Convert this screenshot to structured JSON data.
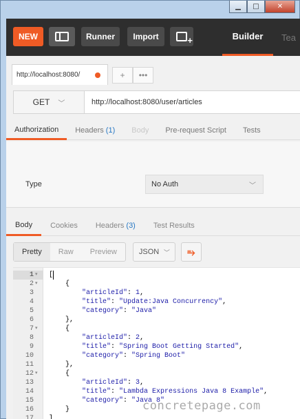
{
  "header": {
    "new_label": "NEW",
    "runner_label": "Runner",
    "import_label": "Import",
    "builder_tab": "Builder",
    "team_tab": "Tea"
  },
  "request_tab": {
    "label": "http://localhost:8080/",
    "add_label": "+",
    "more_label": "•••"
  },
  "request": {
    "method": "GET",
    "url": "http://localhost:8080/user/articles"
  },
  "request_tabs": {
    "authorization": "Authorization",
    "headers": "Headers",
    "headers_count": "(1)",
    "body": "Body",
    "prerequest": "Pre-request Script",
    "tests": "Tests"
  },
  "auth": {
    "type_label": "Type",
    "type_value": "No Auth"
  },
  "response_tabs": {
    "body": "Body",
    "cookies": "Cookies",
    "headers": "Headers",
    "headers_count": "(3)",
    "test_results": "Test Results"
  },
  "view": {
    "pretty": "Pretty",
    "raw": "Raw",
    "preview": "Preview",
    "format": "JSON"
  },
  "code_lines": [
    {
      "n": "1",
      "fold": "▾",
      "text": "["
    },
    {
      "n": "2",
      "fold": "▾",
      "text": "    {"
    },
    {
      "n": "3",
      "fold": "",
      "text": "        \"articleId\": 1,"
    },
    {
      "n": "4",
      "fold": "",
      "text": "        \"title\": \"Update:Java Concurrency\","
    },
    {
      "n": "5",
      "fold": "",
      "text": "        \"category\": \"Java\""
    },
    {
      "n": "6",
      "fold": "",
      "text": "    },"
    },
    {
      "n": "7",
      "fold": "▾",
      "text": "    {"
    },
    {
      "n": "8",
      "fold": "",
      "text": "        \"articleId\": 2,"
    },
    {
      "n": "9",
      "fold": "",
      "text": "        \"title\": \"Spring Boot Getting Started\","
    },
    {
      "n": "10",
      "fold": "",
      "text": "        \"category\": \"Spring Boot\""
    },
    {
      "n": "11",
      "fold": "",
      "text": "    },"
    },
    {
      "n": "12",
      "fold": "▾",
      "text": "    {"
    },
    {
      "n": "13",
      "fold": "",
      "text": "        \"articleId\": 3,"
    },
    {
      "n": "14",
      "fold": "",
      "text": "        \"title\": \"Lambda Expressions Java 8 Example\","
    },
    {
      "n": "15",
      "fold": "",
      "text": "        \"category\": \"Java 8\""
    },
    {
      "n": "16",
      "fold": "",
      "text": "    }"
    },
    {
      "n": "17",
      "fold": "",
      "text": "]"
    }
  ],
  "watermark": "concretepage.com",
  "colors": {
    "accent": "#ef5b25",
    "header_bg": "#2e2e2e",
    "link_count": "#2778c4"
  },
  "icons": {
    "minimize": "minimize-icon",
    "maximize": "maximize-icon",
    "close": "close-icon",
    "sidebar": "sidebar-toggle-icon",
    "new_window": "new-window-icon",
    "wrap": "wrap-lines-icon"
  }
}
